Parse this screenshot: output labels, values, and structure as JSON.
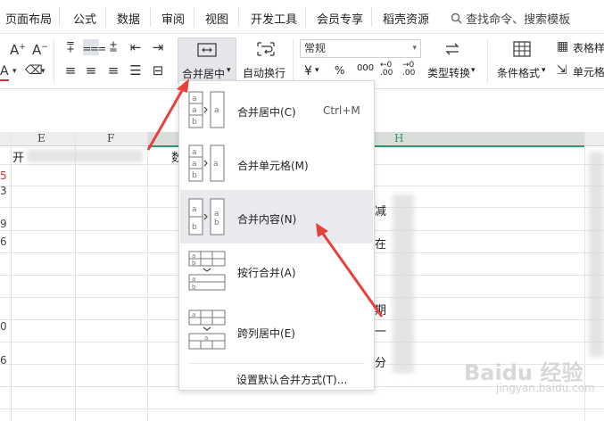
{
  "menubar": {
    "items": [
      "页面布局",
      "公式",
      "数据",
      "审阅",
      "视图",
      "开发工具",
      "会员专享",
      "稻壳资源"
    ],
    "search": "查找命令、搜索模板"
  },
  "ribbon": {
    "merge_label": "合并居中",
    "wrap_label": "自动换行",
    "number_format": "常规",
    "currency_symbol": "¥",
    "percent_symbol": "%",
    "thousands": "000",
    "dec_increase": "←0 .00",
    "dec_decrease": "→0 .00",
    "type_convert_label": "类型转换",
    "cond_format_label": "条件格式",
    "table_style_label": "表格样",
    "cell_label": "单元格"
  },
  "sheet": {
    "columns": [
      "E",
      "F",
      "H"
    ],
    "row_numbers": [
      "5",
      "3",
      "9",
      "6",
      "0",
      "6"
    ],
    "cells": [
      "开",
      "数",
      "减",
      "在",
      "期",
      "一",
      "分"
    ]
  },
  "merge_menu": {
    "items": [
      {
        "label": "合并居中(C)",
        "shortcut": "Ctrl+M"
      },
      {
        "label": "合并单元格(M)",
        "shortcut": ""
      },
      {
        "label": "合并内容(N)",
        "shortcut": ""
      },
      {
        "label": "按行合并(A)",
        "shortcut": ""
      },
      {
        "label": "跨列居中(E)",
        "shortcut": ""
      }
    ],
    "footer": "设置默认合并方式(T)..."
  },
  "watermark": {
    "logo": "Baidu 经验",
    "sub": "jingyan.baidu.com"
  },
  "colors": {
    "accent_green": "#2e9a6c",
    "arrow_red": "#e8403a",
    "hover_bg": "#e8eaee"
  }
}
